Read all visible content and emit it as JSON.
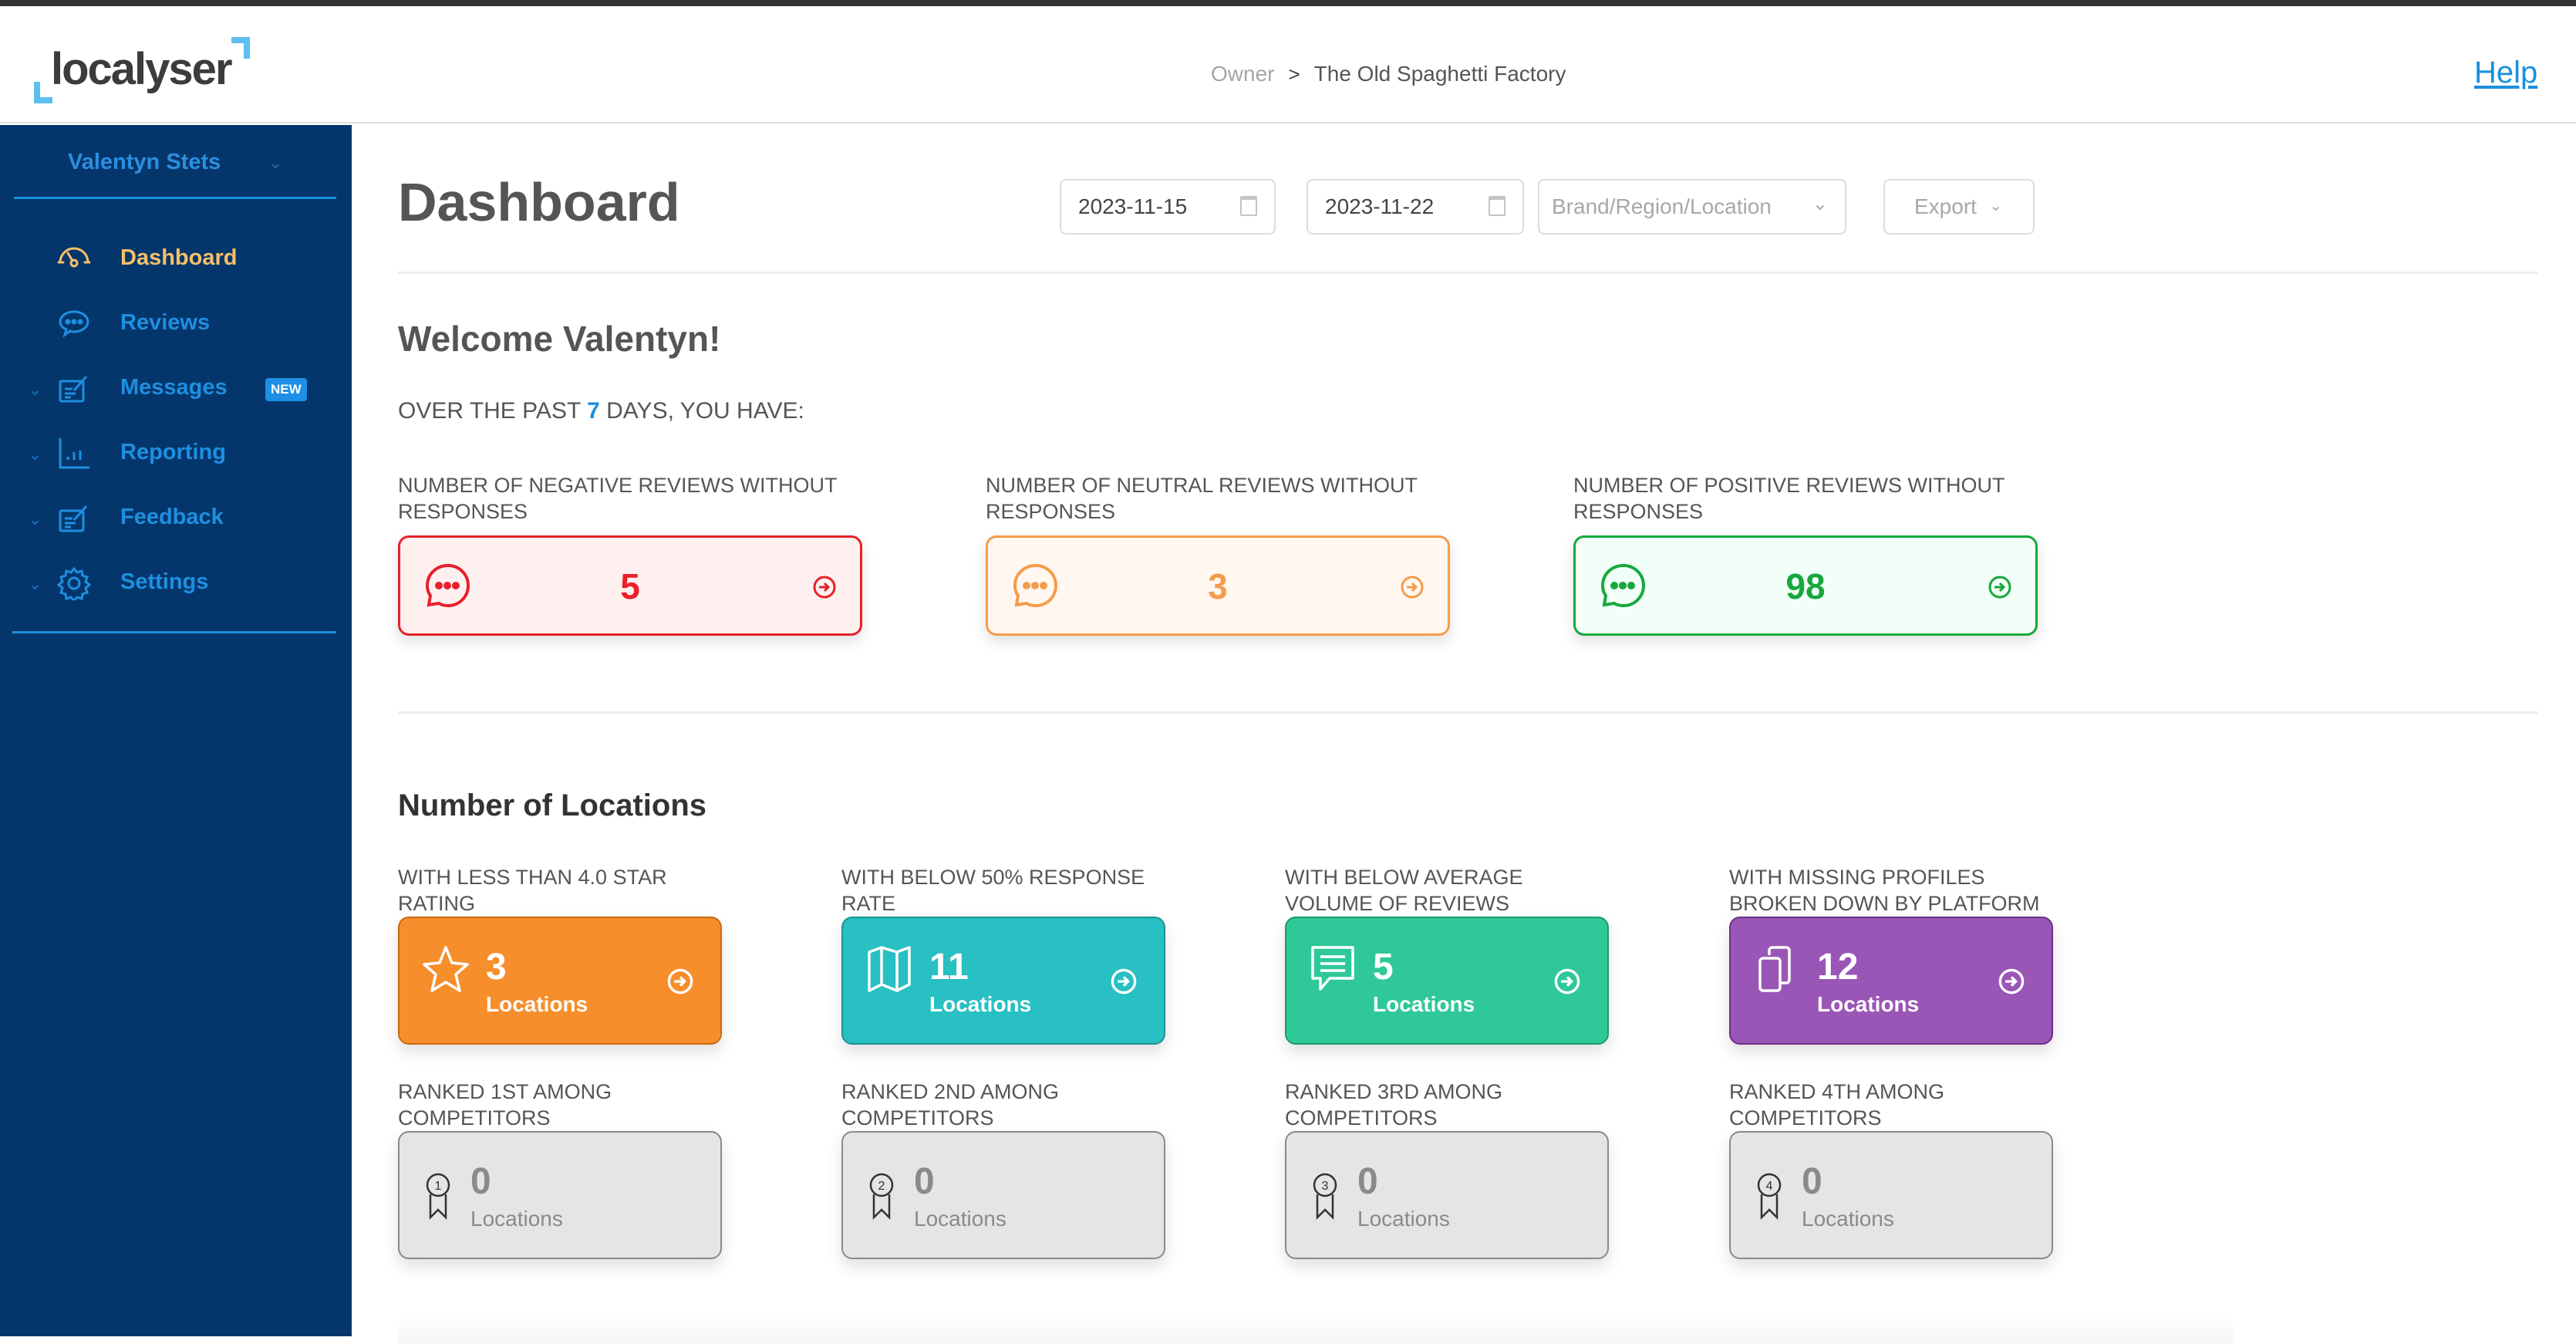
{
  "app": {
    "logo_text": "localyser",
    "brand_colors": {
      "sidebar": "#05366b",
      "accent": "#1e8fe0",
      "active": "#f6c06a",
      "logo_accent": "#5bc0f0"
    }
  },
  "header": {
    "breadcrumb": {
      "root": "Owner",
      "separator": ">",
      "current": "The Old Spaghetti Factory"
    },
    "help_label": "Help"
  },
  "sidebar": {
    "user_name": "Valentyn Stets",
    "items": [
      {
        "label": "Dashboard",
        "icon": "gauge-icon",
        "active": true,
        "expandable": false
      },
      {
        "label": "Reviews",
        "icon": "chat-bubble-icon",
        "active": false,
        "expandable": false
      },
      {
        "label": "Messages",
        "icon": "edit-note-icon",
        "active": false,
        "expandable": true,
        "badge": "NEW"
      },
      {
        "label": "Reporting",
        "icon": "bar-chart-icon",
        "active": false,
        "expandable": true
      },
      {
        "label": "Feedback",
        "icon": "edit-note-icon",
        "active": false,
        "expandable": true
      },
      {
        "label": "Settings",
        "icon": "gear-icon",
        "active": false,
        "expandable": true
      }
    ]
  },
  "main": {
    "title": "Dashboard",
    "filters": {
      "date_from": "2023-11-15",
      "date_to": "2023-11-22",
      "location_placeholder": "Brand/Region/Location",
      "export_label": "Export"
    },
    "welcome": "Welcome Valentyn!",
    "period": {
      "prefix": "OVER THE PAST",
      "days": "7",
      "suffix": "DAYS, YOU HAVE:"
    },
    "review_cards": [
      {
        "label": "NUMBER OF NEGATIVE REVIEWS WITHOUT RESPONSES",
        "count": "5",
        "sentiment": "negative",
        "color": "#e8202a"
      },
      {
        "label": "NUMBER OF NEUTRAL REVIEWS WITHOUT RESPONSES",
        "count": "3",
        "sentiment": "neutral",
        "color": "#f59c4c"
      },
      {
        "label": "NUMBER OF POSITIVE REVIEWS WITHOUT RESPONSES",
        "count": "98",
        "sentiment": "positive",
        "color": "#17a83c"
      }
    ],
    "locations_title": "Number of Locations",
    "location_cards": [
      {
        "label": "WITH LESS THAN 4.0 STAR RATING",
        "count": "3",
        "unit": "Locations",
        "icon": "star-icon",
        "color": "#f78e2c"
      },
      {
        "label": "WITH BELOW 50% RESPONSE RATE",
        "count": "11",
        "unit": "Locations",
        "icon": "map-icon",
        "color": "#28c0c2"
      },
      {
        "label": "WITH BELOW AVERAGE VOLUME OF REVIEWS",
        "count": "5",
        "unit": "Locations",
        "icon": "message-lines-icon",
        "color": "#2fc898"
      },
      {
        "label": "WITH MISSING PROFILES BROKEN DOWN BY PLATFORM",
        "count": "12",
        "unit": "Locations",
        "icon": "copy-icon",
        "color": "#9a56b6"
      }
    ],
    "rank_cards": [
      {
        "label": "RANKED 1ST AMONG COMPETITORS",
        "count": "0",
        "unit": "Locations",
        "rank": "1"
      },
      {
        "label": "RANKED 2ND AMONG COMPETITORS",
        "count": "0",
        "unit": "Locations",
        "rank": "2"
      },
      {
        "label": "RANKED 3RD AMONG COMPETITORS",
        "count": "0",
        "unit": "Locations",
        "rank": "3"
      },
      {
        "label": "RANKED 4TH AMONG COMPETITORS",
        "count": "0",
        "unit": "Locations",
        "rank": "4"
      }
    ]
  }
}
